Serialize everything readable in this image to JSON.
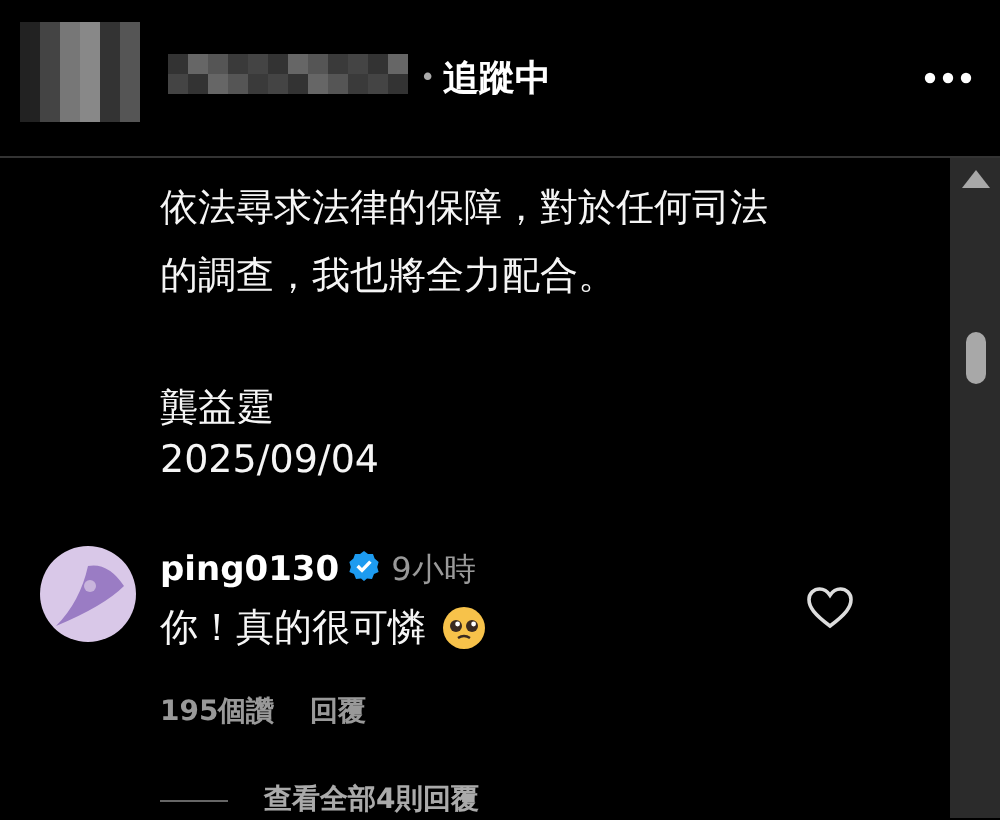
{
  "header": {
    "separator": "•",
    "follow_status": "追蹤中"
  },
  "caption": {
    "lines": [
      "依法尋求法律的保障，對於任何司法",
      "的調查，我也將全力配合。"
    ],
    "signature": "龔益霆",
    "date": "2025/09/04"
  },
  "comment": {
    "username": "ping0130",
    "verified": true,
    "time": "9小時",
    "text": "你！真的很可憐",
    "liked": false,
    "likes": "195個讚",
    "reply": "回覆",
    "view_replies": "查看全部4則回覆"
  }
}
